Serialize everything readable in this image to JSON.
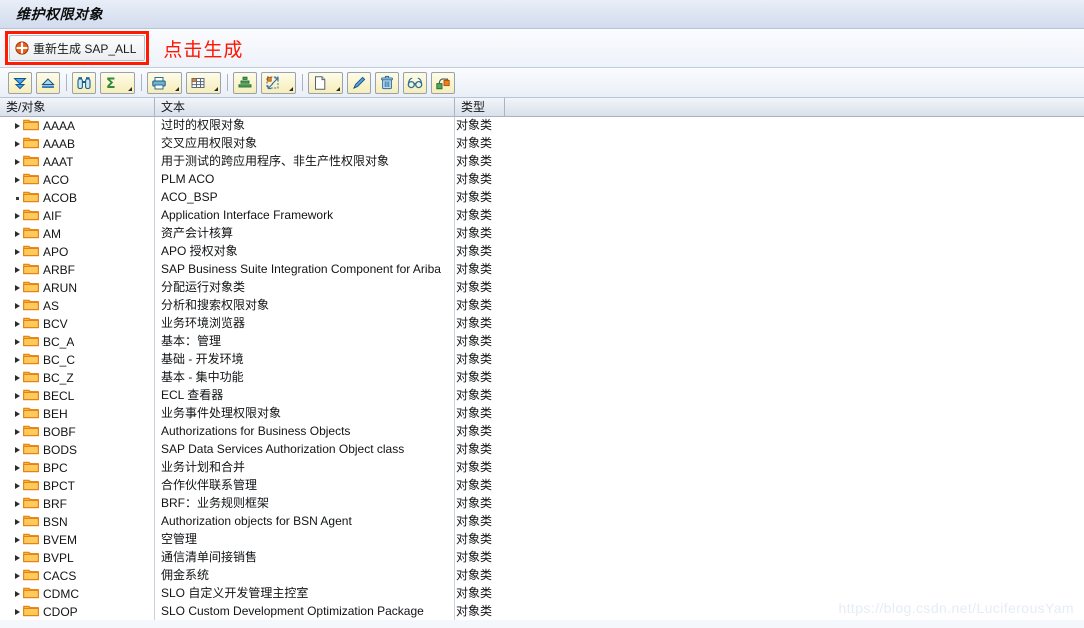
{
  "window": {
    "title": "维护权限对象"
  },
  "action_bar": {
    "generate_button": {
      "label": "重新生成 SAP_ALL",
      "icon": "refresh-circle-icon"
    },
    "annotation": "点击生成",
    "highlight_color": "#ff1a00"
  },
  "toolbar": {
    "buttons": [
      {
        "name": "expand-all-button",
        "icon": "double-chevron-down-icon",
        "tooltip": "展开全部",
        "has_dropdown": false
      },
      {
        "name": "collapse-all-button",
        "icon": "chevron-up-icon",
        "tooltip": "折叠全部",
        "has_dropdown": false
      },
      {
        "name": "find-button",
        "icon": "binoculars-icon",
        "tooltip": "查找",
        "has_dropdown": false
      },
      {
        "name": "sum-button",
        "icon": "sigma-icon",
        "tooltip": "合计",
        "has_dropdown": true
      },
      {
        "name": "print-button",
        "icon": "printer-icon",
        "tooltip": "打印",
        "has_dropdown": true
      },
      {
        "name": "layout-button",
        "icon": "table-layout-icon",
        "tooltip": "更改布局",
        "has_dropdown": true
      },
      {
        "name": "sort-button",
        "icon": "sort-stack-icon",
        "tooltip": "排序",
        "has_dropdown": false
      },
      {
        "name": "expand-node-button",
        "icon": "expand-arrows-icon",
        "tooltip": "展开节点",
        "has_dropdown": true
      },
      {
        "name": "new-button",
        "icon": "new-document-icon",
        "tooltip": "新建",
        "has_dropdown": true
      },
      {
        "name": "edit-button",
        "icon": "pencil-icon",
        "tooltip": "修改",
        "has_dropdown": false
      },
      {
        "name": "delete-button",
        "icon": "trash-icon",
        "tooltip": "删除",
        "has_dropdown": false
      },
      {
        "name": "display-button",
        "icon": "glasses-icon",
        "tooltip": "显示",
        "has_dropdown": false
      },
      {
        "name": "transport-button",
        "icon": "transport-icon",
        "tooltip": "传输",
        "has_dropdown": false
      }
    ]
  },
  "table": {
    "columns": [
      {
        "key": "class_object",
        "label": "类/对象"
      },
      {
        "key": "text",
        "label": "文本"
      },
      {
        "key": "type",
        "label": "类型"
      },
      {
        "key": "spare",
        "label": ""
      }
    ],
    "rows": [
      {
        "marker": "arrow",
        "class_object": "AAAA",
        "text": "过时的权限对象",
        "type": "对象类"
      },
      {
        "marker": "arrow",
        "class_object": "AAAB",
        "text": "交叉应用权限对象",
        "type": "对象类"
      },
      {
        "marker": "arrow",
        "class_object": "AAAT",
        "text": "用于测试的跨应用程序、非生产性权限对象",
        "type": "对象类"
      },
      {
        "marker": "arrow",
        "class_object": "ACO",
        "text": "PLM ACO",
        "type": "对象类"
      },
      {
        "marker": "dot",
        "class_object": "ACOB",
        "text": "ACO_BSP",
        "type": "对象类"
      },
      {
        "marker": "arrow",
        "class_object": "AIF",
        "text": "Application Interface Framework",
        "type": "对象类"
      },
      {
        "marker": "arrow",
        "class_object": "AM",
        "text": "资产会计核算",
        "type": "对象类"
      },
      {
        "marker": "arrow",
        "class_object": "APO",
        "text": "APO 授权对象",
        "type": "对象类"
      },
      {
        "marker": "arrow",
        "class_object": "ARBF",
        "text": "SAP Business Suite Integration Component for Ariba",
        "type": "对象类"
      },
      {
        "marker": "arrow",
        "class_object": "ARUN",
        "text": "分配运行对象类",
        "type": "对象类"
      },
      {
        "marker": "arrow",
        "class_object": "AS",
        "text": "分析和搜索权限对象",
        "type": "对象类"
      },
      {
        "marker": "arrow",
        "class_object": "BCV",
        "text": "业务环境浏览器",
        "type": "对象类"
      },
      {
        "marker": "arrow",
        "class_object": "BC_A",
        "text": "基本：管理",
        "type": "对象类"
      },
      {
        "marker": "arrow",
        "class_object": "BC_C",
        "text": "基础 - 开发环境",
        "type": "对象类"
      },
      {
        "marker": "arrow",
        "class_object": "BC_Z",
        "text": "基本 - 集中功能",
        "type": "对象类"
      },
      {
        "marker": "arrow",
        "class_object": "BECL",
        "text": "ECL 查看器",
        "type": "对象类"
      },
      {
        "marker": "arrow",
        "class_object": "BEH",
        "text": "业务事件处理权限对象",
        "type": "对象类"
      },
      {
        "marker": "arrow",
        "class_object": "BOBF",
        "text": "Authorizations for Business Objects",
        "type": "对象类"
      },
      {
        "marker": "arrow",
        "class_object": "BODS",
        "text": "SAP Data Services Authorization Object class",
        "type": "对象类"
      },
      {
        "marker": "arrow",
        "class_object": "BPC",
        "text": "业务计划和合并",
        "type": "对象类"
      },
      {
        "marker": "arrow",
        "class_object": "BPCT",
        "text": "合作伙伴联系管理",
        "type": "对象类"
      },
      {
        "marker": "arrow",
        "class_object": "BRF",
        "text": "BRF：业务规则框架",
        "type": "对象类"
      },
      {
        "marker": "arrow",
        "class_object": "BSN",
        "text": "Authorization objects for BSN Agent",
        "type": "对象类"
      },
      {
        "marker": "arrow",
        "class_object": "BVEM",
        "text": "空管理",
        "type": "对象类"
      },
      {
        "marker": "arrow",
        "class_object": "BVPL",
        "text": "通信清单间接销售",
        "type": "对象类"
      },
      {
        "marker": "arrow",
        "class_object": "CACS",
        "text": "佣金系统",
        "type": "对象类"
      },
      {
        "marker": "arrow",
        "class_object": "CDMC",
        "text": "SLO 自定义开发管理主控室",
        "type": "对象类"
      },
      {
        "marker": "arrow",
        "class_object": "CDOP",
        "text": "SLO Custom Development Optimization Package",
        "type": "对象类"
      }
    ]
  },
  "watermark": {
    "text": "https://blog.csdn.net/LuciferousYam"
  }
}
